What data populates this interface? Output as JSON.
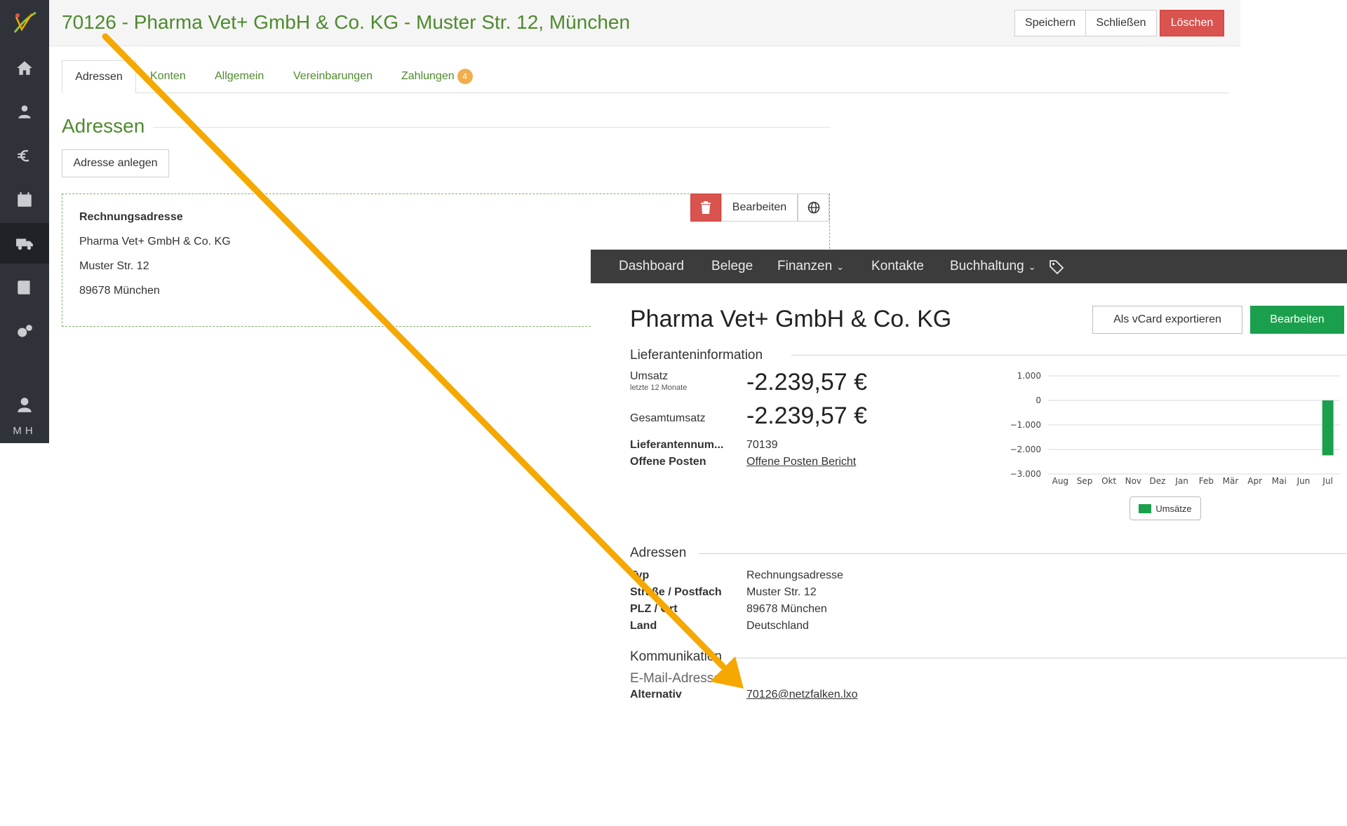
{
  "sidebar": {
    "initials": "MH",
    "items": [
      "home-icon",
      "customers-icon",
      "euro-icon",
      "calendar-icon",
      "truck-icon",
      "book-icon",
      "settings-icon",
      "user-icon"
    ]
  },
  "header": {
    "title": "70126 - Pharma Vet+ GmbH & Co. KG - Muster Str. 12, München",
    "save_label": "Speichern",
    "close_label": "Schließen",
    "delete_label": "Löschen"
  },
  "tabs": [
    {
      "label": "Adressen"
    },
    {
      "label": "Konten"
    },
    {
      "label": "Allgemein"
    },
    {
      "label": "Vereinbarungen"
    },
    {
      "label": "Zahlungen",
      "badge": "4"
    }
  ],
  "section": {
    "title": "Adressen",
    "create_label": "Adresse anlegen"
  },
  "address_card": {
    "type": "Rechnungsadresse",
    "name": "Pharma Vet+ GmbH & Co. KG",
    "street": "Muster Str. 12",
    "city": "89678 München",
    "edit_label": "Bearbeiten"
  },
  "overlay": {
    "nav": {
      "dashboard": "Dashboard",
      "belege": "Belege",
      "finanzen": "Finanzen",
      "kontakte": "Kontakte",
      "buchhaltung": "Buchhaltung"
    },
    "company": "Pharma Vet+ GmbH & Co. KG",
    "vcard_label": "Als vCard exportieren",
    "edit_label": "Bearbeiten",
    "supplier_heading": "Lieferanteninformation",
    "umsatz_label": "Umsatz",
    "umsatz_sub": "letzte 12 Monate",
    "umsatz_value": "-2.239,57 €",
    "gesamt_label": "Gesamtumsatz",
    "gesamt_value": "-2.239,57 €",
    "supplier_no_label": "Lieferantennum...",
    "supplier_no": "70139",
    "open_items_label": "Offene Posten",
    "open_items_link": "Offene Posten Bericht",
    "addresses_heading": "Adressen",
    "typ_label": "Typ",
    "typ_value": "Rechnungsadresse",
    "street_label": "Straße / Postfach",
    "street_value": "Muster Str. 12",
    "plz_label": "PLZ / Ort",
    "plz_value": "89678 München",
    "land_label": "Land",
    "land_value": "Deutschland",
    "comm_heading": "Kommunikation",
    "email_heading": "E-Mail-Adressen",
    "alt_label": "Alternativ",
    "alt_value": "70126@netzfalken.lxo"
  },
  "chart_data": {
    "type": "bar",
    "categories": [
      "Aug",
      "Sep",
      "Okt",
      "Nov",
      "Dez",
      "Jan",
      "Feb",
      "Mär",
      "Apr",
      "Mai",
      "Jun",
      "Jul"
    ],
    "series": [
      {
        "name": "Umsätze",
        "values": [
          0,
          0,
          0,
          0,
          0,
          0,
          0,
          0,
          0,
          0,
          0,
          -2239.57
        ]
      }
    ],
    "ylim": [
      -3000,
      1000
    ],
    "yticks": [
      "1.000",
      "0",
      "−1.000",
      "−2.000",
      "−3.000"
    ],
    "grid": true,
    "legend": "bottom",
    "color": "#1aa04c"
  },
  "colors": {
    "accent": "#4e8a2e",
    "danger": "#d9534f",
    "success": "#1aa04c",
    "arrow": "#f5a800"
  }
}
